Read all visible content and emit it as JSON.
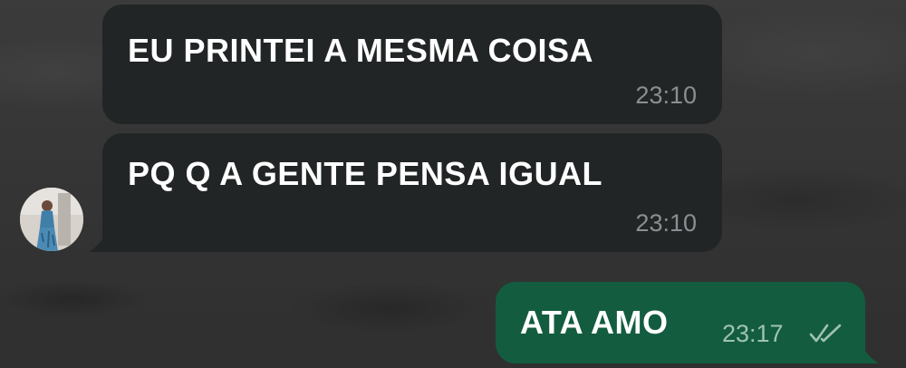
{
  "messages": [
    {
      "direction": "incoming",
      "text": "EU PRINTEI A MESMA COISA",
      "time": "23:10"
    },
    {
      "direction": "incoming",
      "text": "PQ Q A GENTE PENSA IGUAL",
      "time": "23:10"
    },
    {
      "direction": "outgoing",
      "text": "ATA AMO",
      "time": "23:17",
      "status": "read"
    }
  ],
  "icons": {
    "read_receipt": "double-check-icon"
  },
  "colors": {
    "incoming_bubble": "#212526",
    "outgoing_bubble": "#135c40",
    "text": "#ffffff",
    "timestamp_incoming": "#8a8f91",
    "timestamp_outgoing": "#9fc2b3"
  }
}
